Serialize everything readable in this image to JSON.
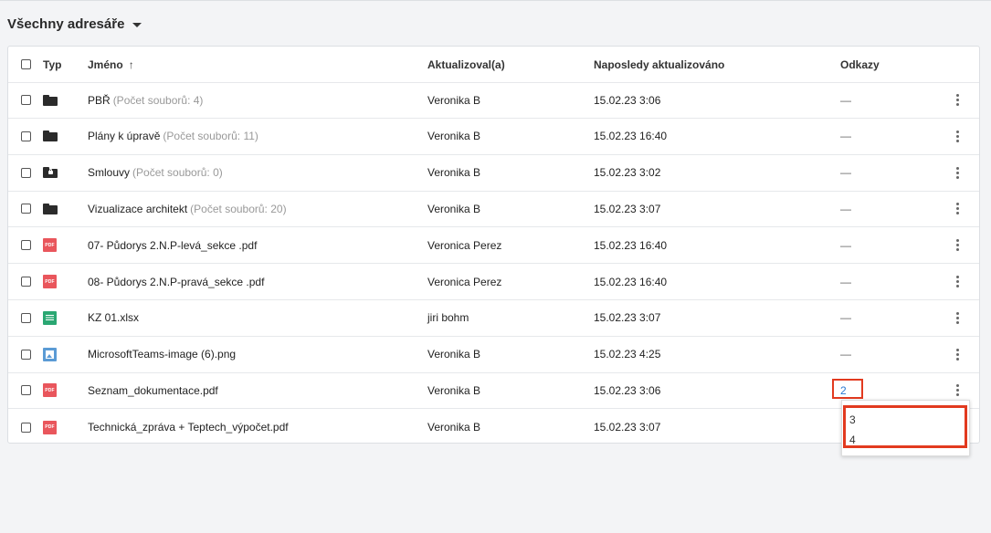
{
  "header": {
    "title": "Všechny adresáře"
  },
  "columns": {
    "type": "Typ",
    "name": "Jméno",
    "updated_by": "Aktualizoval(a)",
    "last_updated": "Naposledy aktualizováno",
    "links": "Odkazy"
  },
  "rows": [
    {
      "icon": "folder-icon",
      "name": "PBŘ",
      "count": "(Počet souborů: 4)",
      "updated_by": "Veronika B",
      "last_updated": "15.02.23 3:06",
      "links": "—"
    },
    {
      "icon": "folder-icon",
      "name": "Plány k úpravě",
      "count": "(Počet souborů: 11)",
      "updated_by": "Veronika B",
      "last_updated": "15.02.23 16:40",
      "links": "—"
    },
    {
      "icon": "locked-folder-icon",
      "name": "Smlouvy",
      "count": "(Počet souborů: 0)",
      "updated_by": "Veronika B",
      "last_updated": "15.02.23 3:02",
      "links": "—"
    },
    {
      "icon": "folder-icon",
      "name": "Vizualizace architekt",
      "count": "(Počet souborů: 20)",
      "updated_by": "Veronika B",
      "last_updated": "15.02.23 3:07",
      "links": "—"
    },
    {
      "icon": "pdf-icon",
      "name": "07- Půdorys 2.N.P-levá_sekce .pdf",
      "count": "",
      "updated_by": "Veronica Perez",
      "last_updated": "15.02.23 16:40",
      "links": "—"
    },
    {
      "icon": "pdf-icon",
      "name": "08- Půdorys 2.N.P-pravá_sekce .pdf",
      "count": "",
      "updated_by": "Veronica Perez",
      "last_updated": "15.02.23 16:40",
      "links": "—"
    },
    {
      "icon": "spreadsheet-icon",
      "name": "KZ 01.xlsx",
      "count": "",
      "updated_by": "jiri bohm",
      "last_updated": "15.02.23 3:07",
      "links": "—"
    },
    {
      "icon": "image-icon",
      "name": "MicrosoftTeams-image (6).png",
      "count": "",
      "updated_by": "Veronika B",
      "last_updated": "15.02.23 4:25",
      "links": "—"
    },
    {
      "icon": "pdf-icon",
      "name": "Seznam_dokumentace.pdf",
      "count": "",
      "updated_by": "Veronika B",
      "last_updated": "15.02.23 3:06",
      "links": "2"
    },
    {
      "icon": "pdf-icon",
      "name": "Technická_zpráva + Teptech_výpočet.pdf",
      "count": "",
      "updated_by": "Veronika B",
      "last_updated": "15.02.23 3:07",
      "links": ""
    }
  ],
  "pdf_label": "PDF",
  "links_dropdown": {
    "items": [
      "3",
      "4"
    ]
  },
  "colors": {
    "accent": "#2a7ad2",
    "highlight": "#e23a1f",
    "pdf": "#e9565c",
    "xlsx": "#2aa772",
    "image": "#5b9bd5"
  }
}
